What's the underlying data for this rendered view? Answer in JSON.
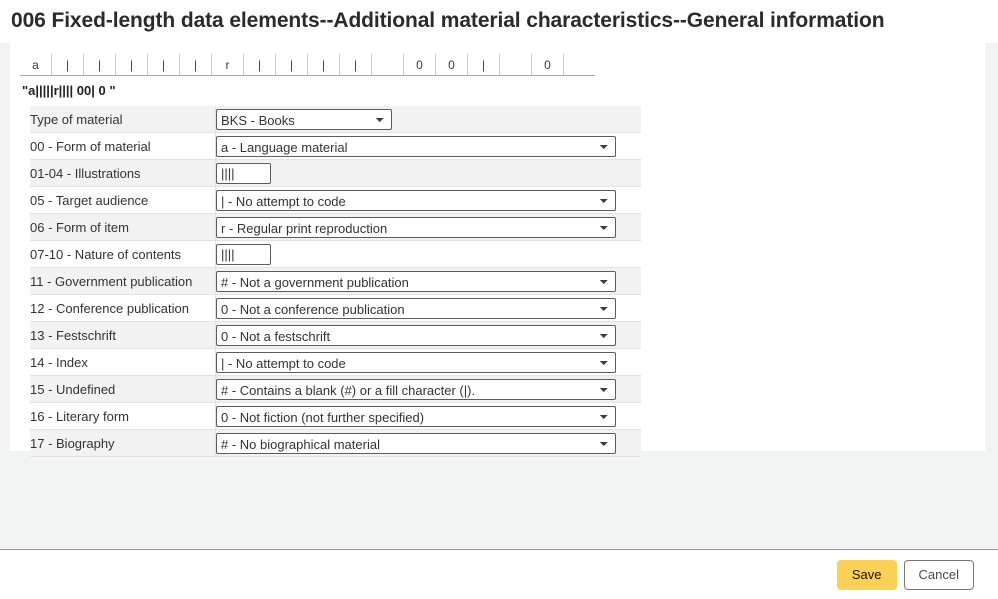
{
  "page": {
    "title": "006 Fixed-length data elements--Additional material characteristics--General information"
  },
  "char_strip": {
    "cells": [
      "a",
      "|",
      "|",
      "|",
      "|",
      "|",
      "r",
      "|",
      "|",
      "|",
      "|",
      "",
      "0",
      "0",
      "|",
      "",
      "0",
      ""
    ],
    "raw_string": "\"a|||||r|||| 00| 0 \""
  },
  "fields": [
    {
      "label": "Type of material",
      "control": "select",
      "width": "short",
      "value": "BKS - Books"
    },
    {
      "label": "00 - Form of material",
      "control": "select",
      "width": "wide",
      "value": "a - Language material"
    },
    {
      "label": "01-04 - Illustrations",
      "control": "input",
      "value": "||||"
    },
    {
      "label": "05 - Target audience",
      "control": "select",
      "width": "wide",
      "value": "| - No attempt to code"
    },
    {
      "label": "06 - Form of item",
      "control": "select",
      "width": "wide",
      "value": "r - Regular print reproduction"
    },
    {
      "label": "07-10 - Nature of contents",
      "control": "input",
      "value": "||||"
    },
    {
      "label": "11 - Government publication",
      "control": "select",
      "width": "wide",
      "value": "# - Not a government publication"
    },
    {
      "label": "12 - Conference publication",
      "control": "select",
      "width": "wide",
      "value": "0 - Not a conference publication"
    },
    {
      "label": "13 - Festschrift",
      "control": "select",
      "width": "wide",
      "value": "0 - Not a festschrift"
    },
    {
      "label": "14 - Index",
      "control": "select",
      "width": "wide",
      "value": "| - No attempt to code"
    },
    {
      "label": "15 - Undefined",
      "control": "select",
      "width": "wide",
      "value": "# - Contains a blank (#) or a fill character (|)."
    },
    {
      "label": "16 - Literary form",
      "control": "select",
      "width": "wide",
      "value": "0 - Not fiction (not further specified)"
    },
    {
      "label": "17 - Biography",
      "control": "select",
      "width": "wide",
      "value": "# - No biographical material"
    }
  ],
  "footer": {
    "save_label": "Save",
    "cancel_label": "Cancel"
  },
  "colors": {
    "save_button": "#fcd054",
    "canvas_background": "#f2f4f3",
    "row_stripe": "#f2f2f2"
  }
}
